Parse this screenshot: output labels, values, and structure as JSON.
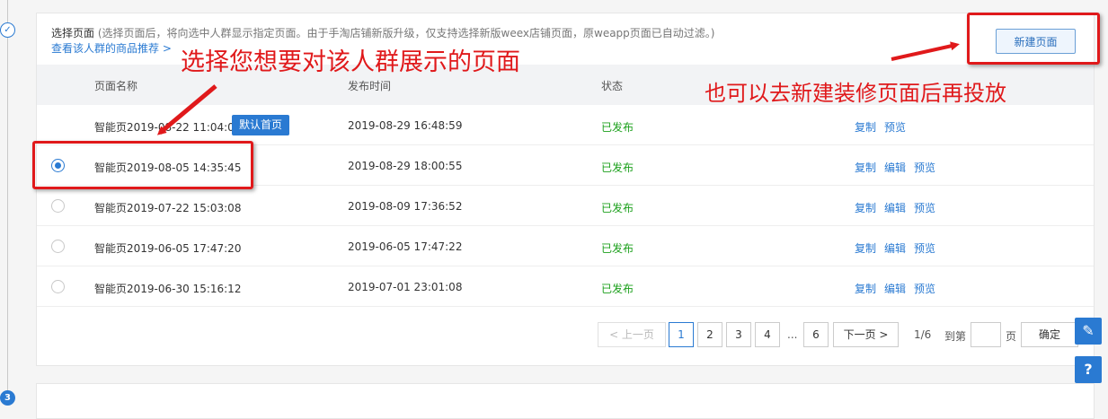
{
  "steps": {
    "current_icon": "check-icon",
    "next_number": "3"
  },
  "section": {
    "title": "选择页面",
    "description": "(选择页面后，将向选中人群显示指定页面。由于手淘店铺新版升级，仅支持选择新版weex店铺页面，原weapp页面已自动过滤。)",
    "link": "查看该人群的商品推荐 >",
    "new_button": "新建页面"
  },
  "table": {
    "headers": {
      "name": "页面名称",
      "time": "发布时间",
      "status": "状态"
    },
    "rows": [
      {
        "name": "智能页2019-08-22 11:04:02",
        "badge": "默认首页",
        "time": "2019-08-29 16:48:59",
        "status": "已发布",
        "copy": "复制",
        "edit": "",
        "preview": "预览",
        "selected": false,
        "has_radio": false
      },
      {
        "name": "智能页2019-08-05 14:35:45",
        "badge": "",
        "time": "2019-08-29 18:00:55",
        "status": "已发布",
        "copy": "复制",
        "edit": "编辑",
        "preview": "预览",
        "selected": true,
        "has_radio": true
      },
      {
        "name": "智能页2019-07-22 15:03:08",
        "badge": "",
        "time": "2019-08-09 17:36:52",
        "status": "已发布",
        "copy": "复制",
        "edit": "编辑",
        "preview": "预览",
        "selected": false,
        "has_radio": true
      },
      {
        "name": "智能页2019-06-05 17:47:20",
        "badge": "",
        "time": "2019-06-05 17:47:22",
        "status": "已发布",
        "copy": "复制",
        "edit": "编辑",
        "preview": "预览",
        "selected": false,
        "has_radio": true
      },
      {
        "name": "智能页2019-06-30 15:16:12",
        "badge": "",
        "time": "2019-07-01 23:01:08",
        "status": "已发布",
        "copy": "复制",
        "edit": "编辑",
        "preview": "预览",
        "selected": false,
        "has_radio": true
      }
    ]
  },
  "pagination": {
    "prev": "< 上一页",
    "pages": [
      "1",
      "2",
      "3",
      "4"
    ],
    "ellipsis": "...",
    "last_page": "6",
    "next": "下一页 >",
    "count": "1/6",
    "goto_prefix": "到第",
    "goto_suffix": "页",
    "confirm": "确定",
    "current": "1"
  },
  "annotations": {
    "left": "选择您想要对该人群展示的页面",
    "right": "也可以去新建装修页面后再投放",
    "color": "#e0191b"
  },
  "side_buttons": {
    "edit": "pencil-icon",
    "help": "?"
  },
  "colors": {
    "accent": "#2a7ad2",
    "status_ok": "#1ca01c"
  }
}
